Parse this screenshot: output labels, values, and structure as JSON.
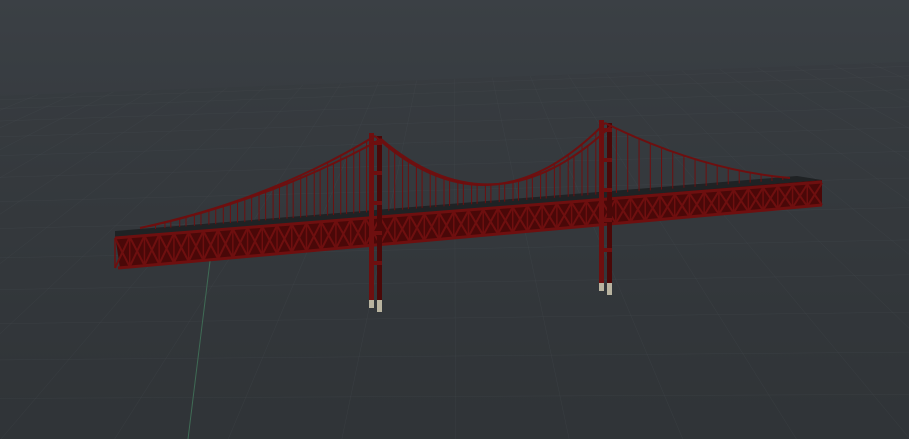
{
  "scene": {
    "colors": {
      "sky_top": "#3b4045",
      "sky_bottom": "#2a2e31",
      "grid": "#4a5055",
      "axis_green": "#3f6b55",
      "steel": "#6e0f0f",
      "steel_dark": "#4a0808",
      "deck": "#1f2224",
      "pier": "#b9b4a0"
    }
  }
}
